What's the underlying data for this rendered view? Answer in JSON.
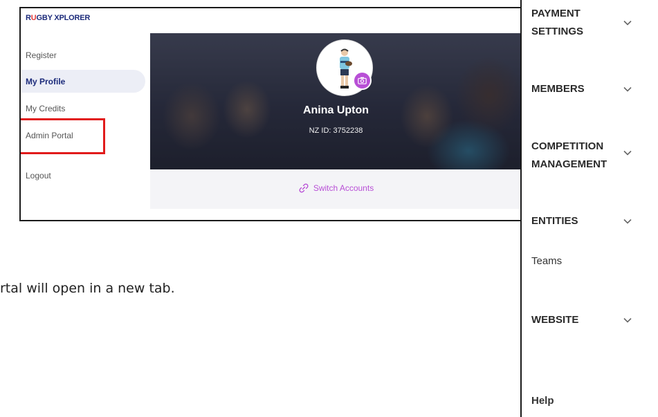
{
  "app": {
    "brand_prefix": "R",
    "brand_accent": "U",
    "brand_suffix": "GBY XPLORER"
  },
  "nav": {
    "items": [
      {
        "label": "Register"
      },
      {
        "label": "My Profile",
        "active": true
      },
      {
        "label": "My Credits"
      },
      {
        "label": "Admin Portal",
        "highlighted": true
      },
      {
        "label": "Logout"
      }
    ]
  },
  "profile": {
    "name": "Anina Upton",
    "id_text": "NZ ID: 3752238",
    "switch_label": "Switch Accounts"
  },
  "caption": {
    "text": "rtal will open in a new tab."
  },
  "sidebar": {
    "payment_line1": "PAYMENT",
    "payment_line2": "SETTINGS",
    "members": "MEMBERS",
    "competition_line1": "COMPETITION",
    "competition_line2": "MANAGEMENT",
    "entities": "ENTITIES",
    "teams": "Teams",
    "website": "WEBSITE",
    "help": "Help"
  },
  "colors": {
    "brand": "#1b2a7a",
    "brand_accent": "#e23a3a",
    "highlight": "#e11b1b",
    "link_purple": "#b84fd6"
  },
  "icons": {
    "chevron": "chevron-down-icon",
    "camera": "camera-icon",
    "link": "link-icon"
  }
}
